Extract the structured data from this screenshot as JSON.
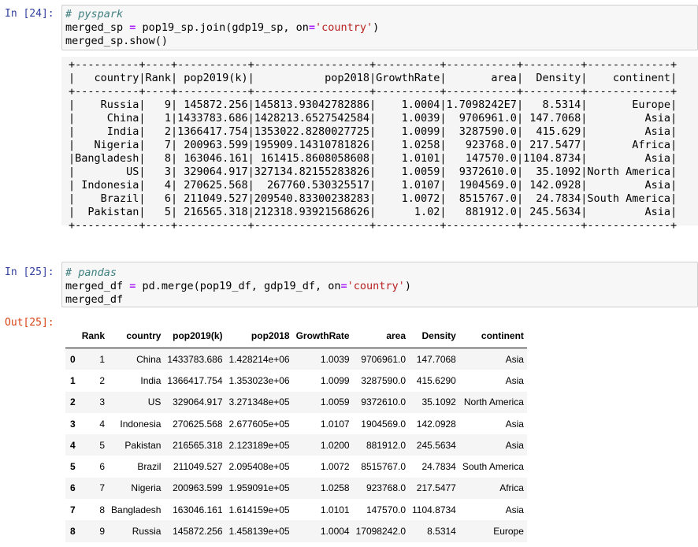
{
  "cells": [
    {
      "prompt": "In [24]:",
      "lines": [
        [
          {
            "t": "# pyspark",
            "c": "cm"
          }
        ],
        [
          {
            "t": "merged_sp "
          },
          {
            "t": "=",
            "c": "op"
          },
          {
            "t": " pop19_sp.join(gdp19_sp, on"
          },
          {
            "t": "=",
            "c": "op"
          },
          {
            "t": "'country'",
            "c": "str"
          },
          {
            "t": ")"
          }
        ],
        [
          {
            "t": "merged_sp.show()"
          }
        ]
      ]
    },
    {
      "prompt": "In [25]:",
      "lines": [
        [
          {
            "t": "# pandas",
            "c": "cm"
          }
        ],
        [
          {
            "t": "merged_df "
          },
          {
            "t": "=",
            "c": "op"
          },
          {
            "t": " pd.merge(pop19_df, gdp19_df, on"
          },
          {
            "t": "=",
            "c": "op"
          },
          {
            "t": "'country'",
            "c": "str"
          },
          {
            "t": ")"
          }
        ],
        [
          {
            "t": "merged_df"
          }
        ]
      ]
    }
  ],
  "spark_output": {
    "border": "+----------+----+-----------+------------------+----------+-----------+---------+-------------+",
    "header": "|   country|Rank| pop2019(k)|           pop2018|GrowthRate|       area|  Density|    continent|",
    "rows": [
      "|    Russia|   9| 145872.256|145813.93042782886|    1.0004|1.7098242E7|   8.5314|       Europe|",
      "|     China|   1|1433783.686|1428213.6527542584|    1.0039|  9706961.0| 147.7068|         Asia|",
      "|     India|   2|1366417.754|1353022.8280027725|    1.0099|  3287590.0|  415.629|         Asia|",
      "|   Nigeria|   7| 200963.599|195909.14310781826|    1.0258|   923768.0| 217.5477|       Africa|",
      "|Bangladesh|   8| 163046.161| 161415.8608058608|    1.0101|   147570.0|1104.8734|         Asia|",
      "|        US|   3| 329064.917|327134.82155283826|    1.0059|  9372610.0|  35.1092|North America|",
      "| Indonesia|   4| 270625.568|  267760.530325517|    1.0107|  1904569.0| 142.0928|         Asia|",
      "|    Brazil|   6| 211049.527|209540.83300238283|    1.0072|  8515767.0|  24.7834|South America|",
      "|  Pakistan|   5| 216565.318|212318.93921568626|      1.02|   881912.0| 245.5634|         Asia|"
    ]
  },
  "out_prompt": "Out[25]:",
  "dataframe": {
    "columns": [
      "",
      "Rank",
      "country",
      "pop2019(k)",
      "pop2018",
      "GrowthRate",
      "area",
      "Density",
      "continent"
    ],
    "rows": [
      [
        "0",
        "1",
        "China",
        "1433783.686",
        "1.428214e+06",
        "1.0039",
        "9706961.0",
        "147.7068",
        "Asia"
      ],
      [
        "1",
        "2",
        "India",
        "1366417.754",
        "1.353023e+06",
        "1.0099",
        "3287590.0",
        "415.6290",
        "Asia"
      ],
      [
        "2",
        "3",
        "US",
        "329064.917",
        "3.271348e+05",
        "1.0059",
        "9372610.0",
        "35.1092",
        "North America"
      ],
      [
        "3",
        "4",
        "Indonesia",
        "270625.568",
        "2.677605e+05",
        "1.0107",
        "1904569.0",
        "142.0928",
        "Asia"
      ],
      [
        "4",
        "5",
        "Pakistan",
        "216565.318",
        "2.123189e+05",
        "1.0200",
        "881912.0",
        "245.5634",
        "Asia"
      ],
      [
        "5",
        "6",
        "Brazil",
        "211049.527",
        "2.095408e+05",
        "1.0072",
        "8515767.0",
        "24.7834",
        "South America"
      ],
      [
        "6",
        "7",
        "Nigeria",
        "200963.599",
        "1.959091e+05",
        "1.0258",
        "923768.0",
        "217.5477",
        "Africa"
      ],
      [
        "7",
        "8",
        "Bangladesh",
        "163046.161",
        "1.614159e+05",
        "1.0101",
        "147570.0",
        "1104.8734",
        "Asia"
      ],
      [
        "8",
        "9",
        "Russia",
        "145872.256",
        "1.458139e+05",
        "1.0004",
        "17098242.0",
        "8.5314",
        "Europe"
      ]
    ]
  }
}
